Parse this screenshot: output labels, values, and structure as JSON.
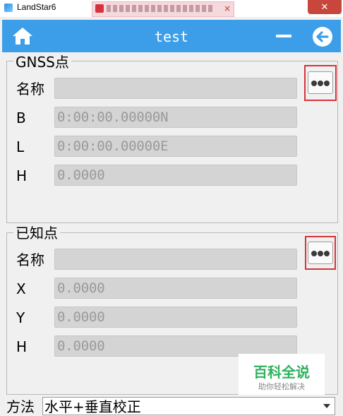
{
  "window": {
    "title": "LandStar6",
    "close_symbol": "✕"
  },
  "header": {
    "title": "test"
  },
  "gnss_group": {
    "label": "GNSS点",
    "fields": [
      {
        "label": "名称",
        "value": ""
      },
      {
        "label": "B",
        "value": "0:00:00.00000N"
      },
      {
        "label": "L",
        "value": "0:00:00.00000E"
      },
      {
        "label": "H",
        "value": "0.0000"
      }
    ]
  },
  "known_group": {
    "label": "已知点",
    "fields": [
      {
        "label": "名称",
        "value": ""
      },
      {
        "label": "X",
        "value": "0.0000"
      },
      {
        "label": "Y",
        "value": "0.0000"
      },
      {
        "label": "H",
        "value": "0.0000"
      }
    ]
  },
  "method": {
    "label": "方法",
    "value": "水平+垂直校正"
  },
  "watermark": {
    "title": "百科全说",
    "subtitle": "助你轻松解决"
  },
  "colors": {
    "header": "#3c9ee8",
    "highlight": "#d6333a",
    "watermark_green": "#2fb15e"
  }
}
